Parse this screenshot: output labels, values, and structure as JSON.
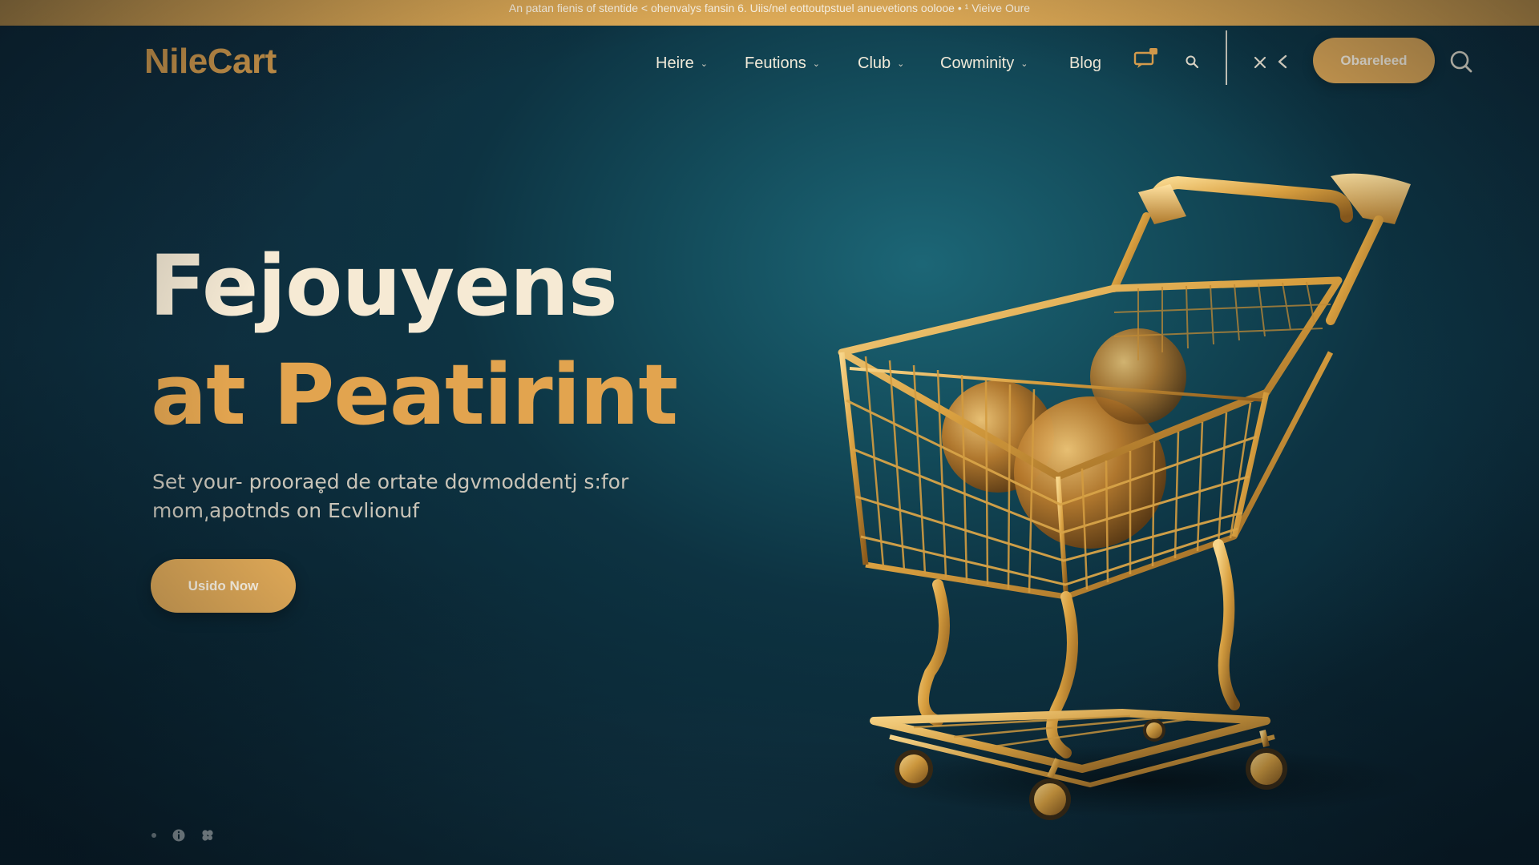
{
  "announcement": {
    "text": "An patan fienis of stentide < ohenvalys fansin 6. Uiis/nel eottoutpstuel anuevetions oolooe • ¹ Vieive Oure"
  },
  "header": {
    "logo": "NileCart",
    "nav": [
      {
        "label": "Heire",
        "has_dropdown": true
      },
      {
        "label": "Feutions",
        "has_dropdown": true
      },
      {
        "label": "Club",
        "has_dropdown": true
      },
      {
        "label": "Cowminity",
        "has_dropdown": true
      },
      {
        "label": "Blog",
        "has_dropdown": false
      }
    ],
    "icons": [
      "chat-icon",
      "search-small-icon",
      "close-icon",
      "chevron-left-icon",
      "search-icon"
    ],
    "cta_label": "Obareleed"
  },
  "hero": {
    "title_line1": "Fejouyens",
    "title_line2": "at Peatirint",
    "subtitle_line1": "Set your- proorae̥d de ortate dgvmoddentj s:for",
    "subtitle_line2": "mom͵apotnds on Ecvlionuf",
    "button_label": "Usido Now"
  },
  "footer_icons": [
    "dot-icon",
    "info-icon",
    "clover-icon"
  ],
  "colors": {
    "accent": "#e0a957",
    "logo": "#e2a44f",
    "background": "#0e2f3f",
    "title": "#f6ead4"
  }
}
